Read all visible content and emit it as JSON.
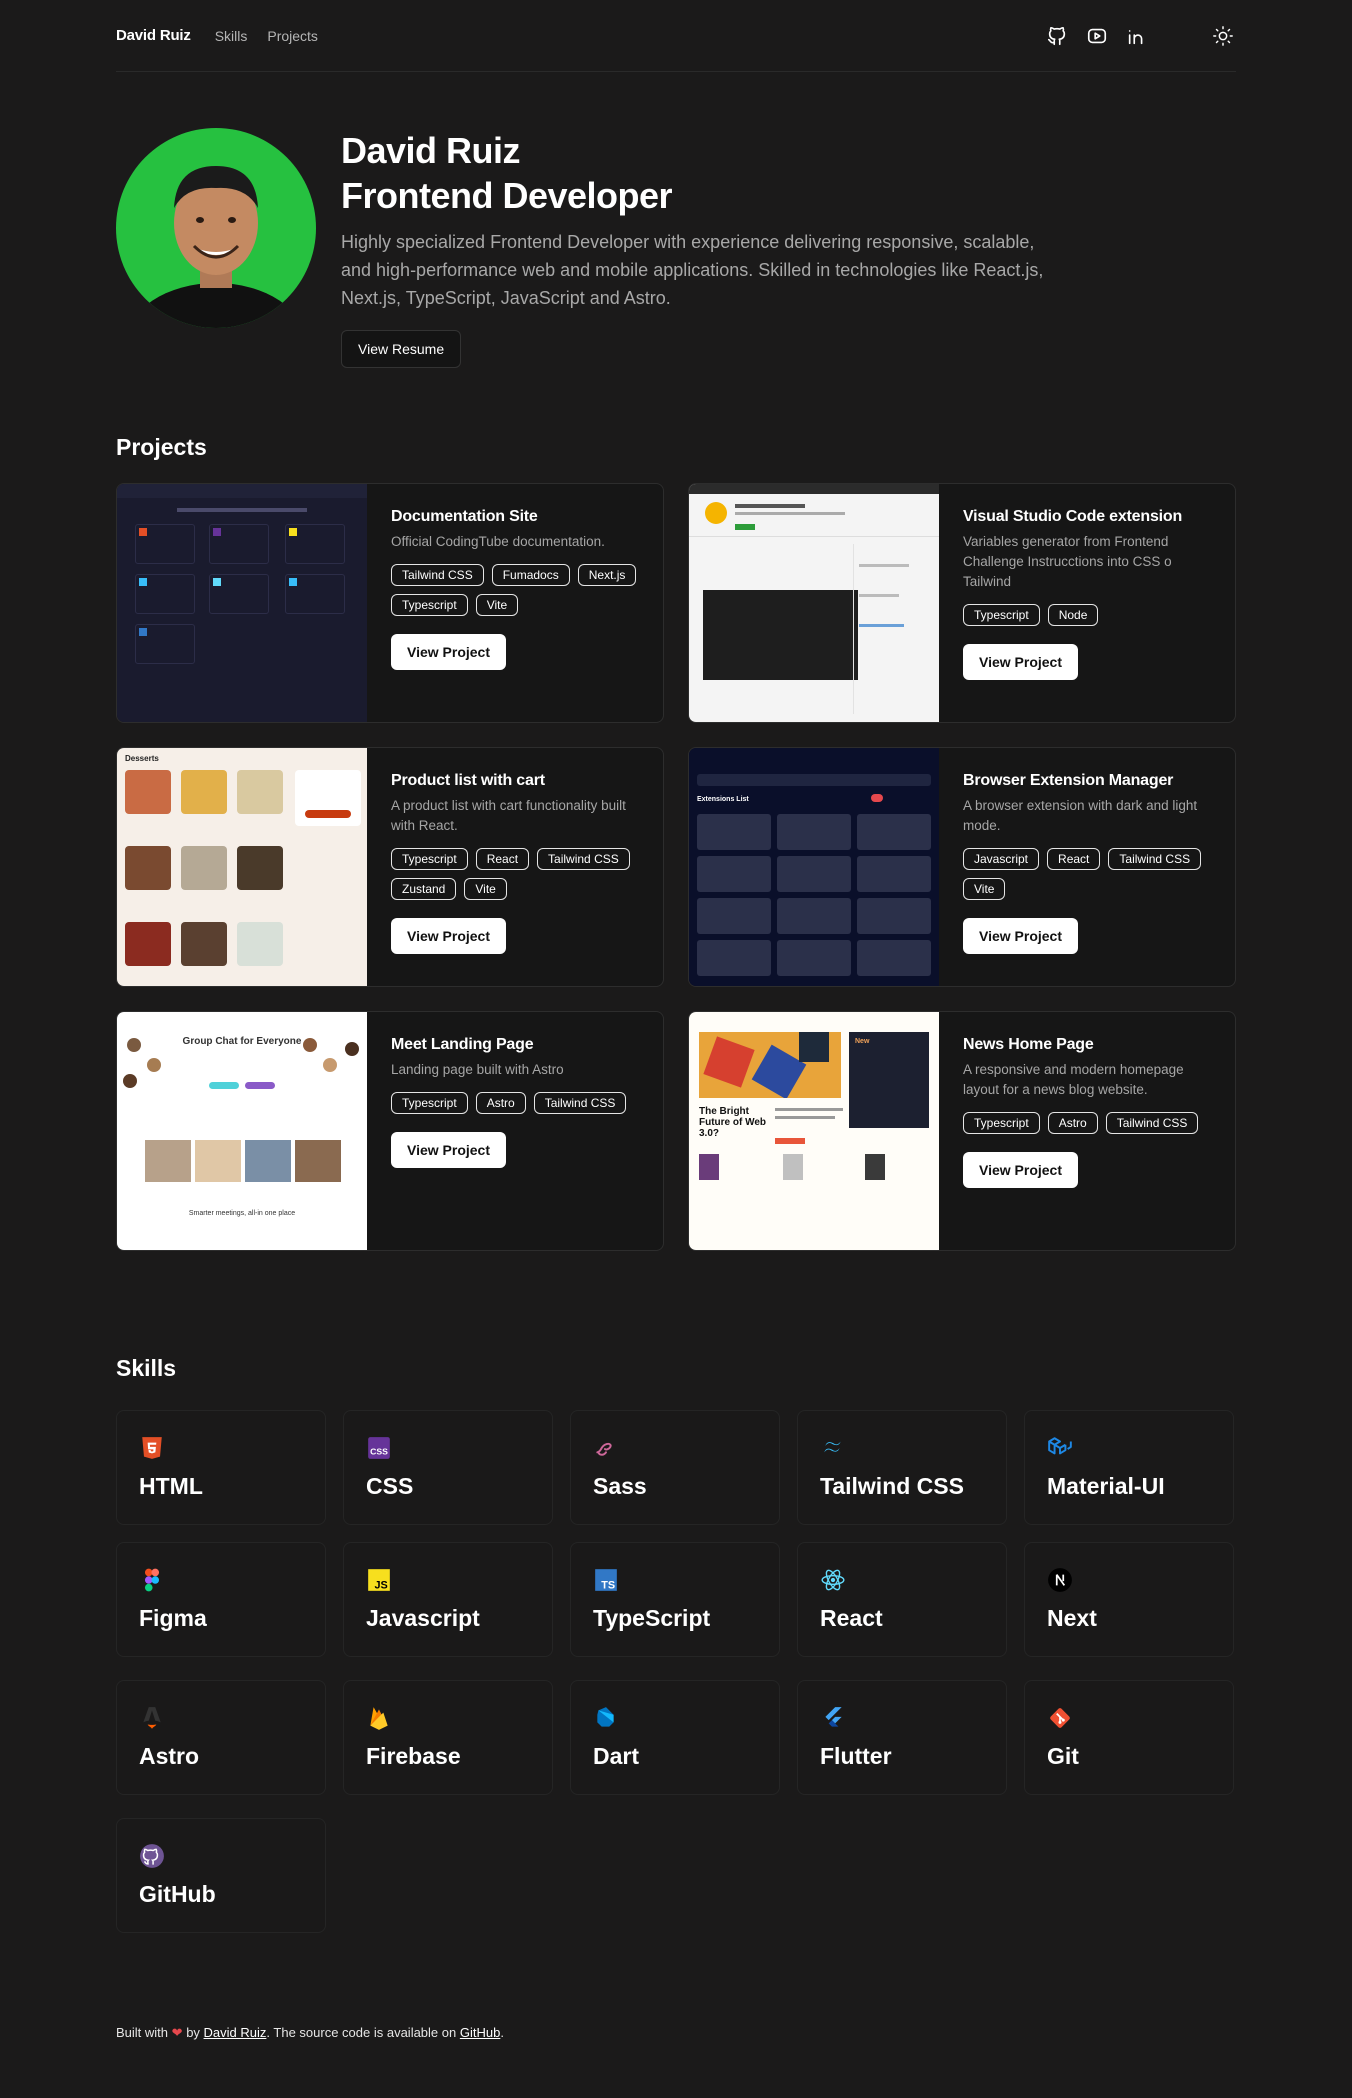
{
  "nav": {
    "brand": "David Ruiz",
    "links": [
      "Skills",
      "Projects"
    ],
    "icons": [
      "github-icon",
      "youtube-icon",
      "linkedin-icon"
    ],
    "theme_icon": "sun-icon"
  },
  "hero": {
    "name": "David Ruiz",
    "role": "Frontend Developer",
    "bio": "Highly specialized Frontend Developer with experience delivering responsive, scalable, and high-performance web and mobile applications. Skilled in technologies like React.js, Next.js, TypeScript, JavaScript and Astro.",
    "button": "View Resume"
  },
  "projects": {
    "title": "Projects",
    "button": "View Project",
    "items": [
      {
        "title": "Documentation Site",
        "desc": "Official CodingTube documentation.",
        "tags": [
          "Tailwind CSS",
          "Fumadocs",
          "Next.js",
          "Typescript",
          "Vite"
        ]
      },
      {
        "title": "Visual Studio Code extension",
        "desc": "Variables generator from Frontend Challenge Instrucctions into CSS o Tailwind",
        "tags": [
          "Typescript",
          "Node"
        ]
      },
      {
        "title": "Product list with cart",
        "desc": "A product list with cart functionality built with React.",
        "tags": [
          "Typescript",
          "React",
          "Tailwind CSS",
          "Zustand",
          "Vite"
        ]
      },
      {
        "title": "Browser Extension Manager",
        "desc": "A browser extension with dark and light mode.",
        "tags": [
          "Javascript",
          "React",
          "Tailwind CSS",
          "Vite"
        ]
      },
      {
        "title": "Meet Landing Page",
        "desc": "Landing page built with Astro",
        "tags": [
          "Typescript",
          "Astro",
          "Tailwind CSS"
        ]
      },
      {
        "title": "News Home Page",
        "desc": "A responsive and modern homepage layout for a news blog website.",
        "tags": [
          "Typescript",
          "Astro",
          "Tailwind CSS"
        ]
      }
    ]
  },
  "thumbs": {
    "desserts": "Desserts",
    "extensions": "Extensions List",
    "meet_title": "Group Chat for Everyone",
    "meet_sub": "Smarter meetings, all-in one place",
    "news_title": "The Bright Future of Web 3.0?",
    "news_new": "New"
  },
  "skills": {
    "title": "Skills",
    "items": [
      {
        "name": "HTML",
        "icon": "html5-icon",
        "color": "#e34f26"
      },
      {
        "name": "CSS",
        "icon": "css-icon",
        "color": "#663399"
      },
      {
        "name": "Sass",
        "icon": "sass-icon",
        "color": "#cd6799"
      },
      {
        "name": "Tailwind CSS",
        "icon": "tailwind-icon",
        "color": "#38bdf8"
      },
      {
        "name": "Material-UI",
        "icon": "mui-icon",
        "color": "#1e88e5"
      },
      {
        "name": "Figma",
        "icon": "figma-icon",
        "color": "#f24e1e"
      },
      {
        "name": "Javascript",
        "icon": "javascript-icon",
        "color": "#f7df1e"
      },
      {
        "name": "TypeScript",
        "icon": "typescript-icon",
        "color": "#3178c6"
      },
      {
        "name": "React",
        "icon": "react-icon",
        "color": "#61dafb"
      },
      {
        "name": "Next",
        "icon": "nextjs-icon",
        "color": "#000000"
      },
      {
        "name": "Astro",
        "icon": "astro-icon",
        "color": "#ff5d01"
      },
      {
        "name": "Firebase",
        "icon": "firebase-icon",
        "color": "#ffca28"
      },
      {
        "name": "Dart",
        "icon": "dart-icon",
        "color": "#0175c2"
      },
      {
        "name": "Flutter",
        "icon": "flutter-icon",
        "color": "#02569b"
      },
      {
        "name": "Git",
        "icon": "git-icon",
        "color": "#f05032"
      },
      {
        "name": "GitHub",
        "icon": "github-icon",
        "color": "#6e5494"
      }
    ]
  },
  "footer": {
    "prefix": "Built with",
    "by": "by",
    "author": "David Ruiz",
    "middle": ". The source code is available on",
    "repo": "GitHub",
    "suffix": "."
  }
}
